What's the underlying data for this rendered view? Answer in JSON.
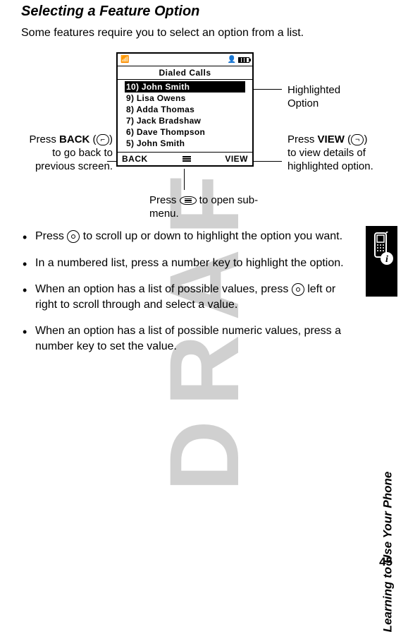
{
  "watermark": "DRAFT",
  "heading": "Selecting a Feature Option",
  "intro": "Some features require you to select an option from a list.",
  "phone": {
    "title": "Dialed Calls",
    "items": [
      "10) John Smith",
      "9) Lisa Owens",
      "8) Adda Thomas",
      "7) Jack Bradshaw",
      "6) Dave Thompson",
      "5) John Smith"
    ],
    "softkey_left": "BACK",
    "softkey_right": "VIEW"
  },
  "callouts": {
    "left_part1": "Press ",
    "left_back": "BACK",
    "left_part2": ") to go back to previous screen.",
    "right_top": "Highlighted Option",
    "right_bottom_part1": "Press ",
    "right_bottom_view": "VIEW",
    "right_bottom_part2": ") to view details of highlighted option.",
    "bottom_part1": "Press ",
    "bottom_part2": " to open sub-menu."
  },
  "bullets": [
    {
      "pre": "Press ",
      "key": "nav",
      "post": " to scroll up or down to highlight the option you want."
    },
    {
      "pre": "In a numbered list, press a number key to highlight the option.",
      "key": "",
      "post": ""
    },
    {
      "pre": "When an option has a list of possible values, press ",
      "key": "nav",
      "post": " left or right to scroll through and select a value."
    },
    {
      "pre": "When an option has a list of possible numeric values, press a number key to set the value.",
      "key": "",
      "post": ""
    }
  ],
  "vertical_label": "Learning to Use Your Phone",
  "page_number": "45"
}
